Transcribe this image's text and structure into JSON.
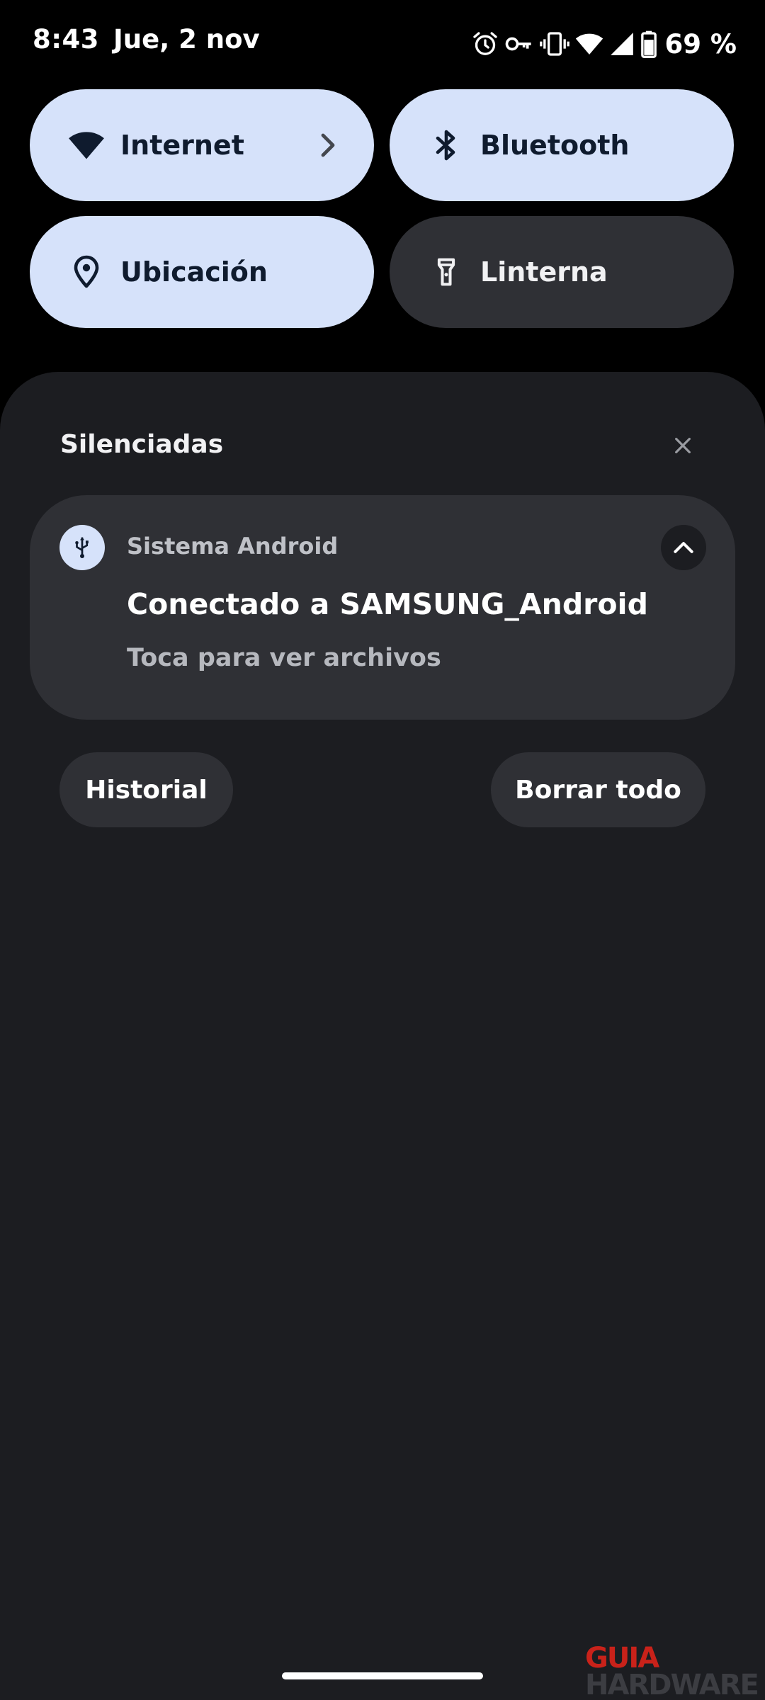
{
  "status_bar": {
    "time": "8:43",
    "date": "Jue, 2 nov",
    "icons": [
      "alarm-icon",
      "vpn-key-icon",
      "vibrate-icon",
      "wifi-icon",
      "cell-signal-icon",
      "battery-icon"
    ],
    "battery": "69 %"
  },
  "quick_settings": {
    "tiles": [
      {
        "label": "Internet",
        "icon": "wifi-icon",
        "state": "on",
        "has_chevron": true
      },
      {
        "label": "Bluetooth",
        "icon": "bluetooth-icon",
        "state": "on"
      },
      {
        "label": "Ubicación",
        "icon": "location-pin-icon",
        "state": "on"
      },
      {
        "label": "Linterna",
        "icon": "flashlight-icon",
        "state": "off"
      }
    ]
  },
  "notifications": {
    "section_title": "Silenciadas",
    "card": {
      "app_name": "Sistema Android",
      "app_icon": "usb-icon",
      "title": "Conectado a SAMSUNG_Android",
      "text": "Toca para ver archivos"
    },
    "history_label": "Historial",
    "clear_all_label": "Borrar todo"
  },
  "watermark": {
    "line1": "GUIA",
    "line2": "HARDWARE"
  },
  "colors": {
    "background": "#000000",
    "shade": "#1c1d21",
    "tile_on": "#d6e2fa",
    "tile_off": "#2f3035",
    "card": "#2f3035",
    "watermark_red": "#c9221a"
  }
}
